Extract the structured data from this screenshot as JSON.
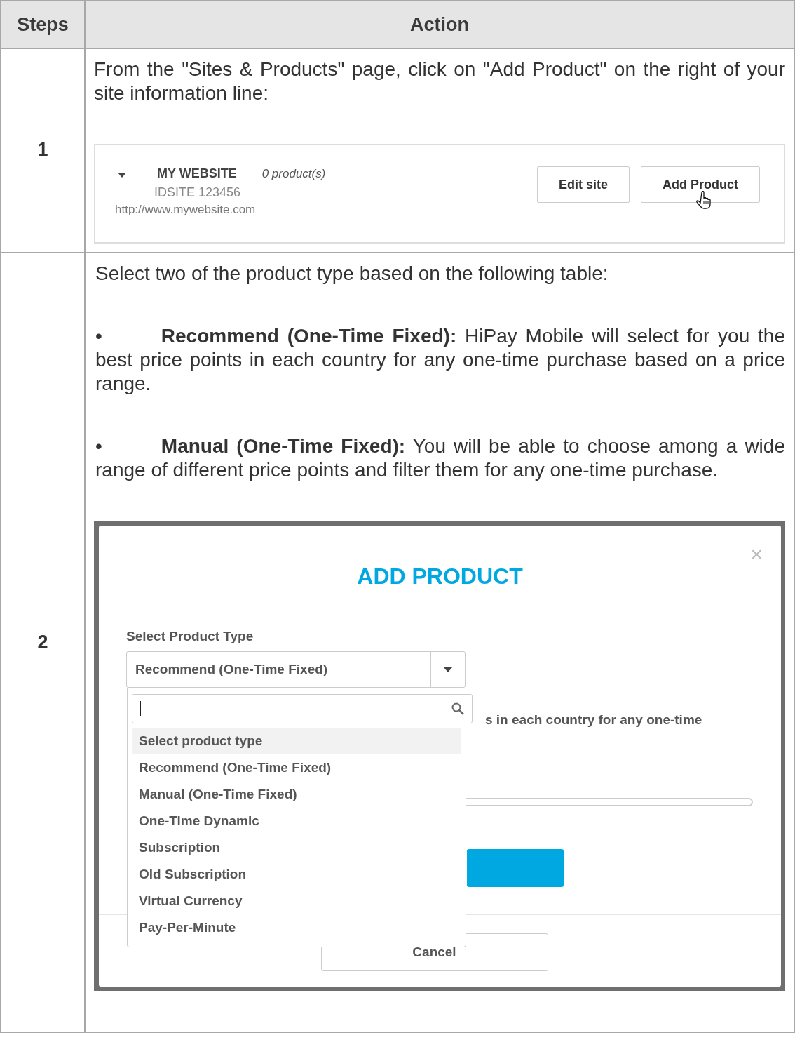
{
  "table": {
    "columns": [
      "Steps",
      "Action"
    ],
    "rows": [
      {
        "step": "1",
        "paragraphs": [
          "From the \"Sites & Products\" page, click on \"Add Product\" on the right of your site information line:"
        ],
        "figure": {
          "kind": "site_line",
          "site_name": "MY WEBSITE",
          "product_count": "0 product(s)",
          "site_id": "IDSITE 123456",
          "url": "http://www.mywebsite.com",
          "buttons": [
            "Edit site",
            "Add Product"
          ]
        }
      },
      {
        "step": "2",
        "paragraphs": [
          "Select two of the product type based on the following table:",
          "•   **Recommend (One-Time Fixed):** HiPay Mobile will select for you the best price points in each country for any one-time purchase based on a price range.",
          "•   **Manual (One-Time Fixed):** You will be able to choose among a wide range of different price points and filter them for any one-time purchase."
        ],
        "figure": {
          "kind": "modal",
          "title": "ADD PRODUCT",
          "close": "×",
          "field_label": "Select Product Type",
          "select_value": "Recommend (One-Time Fixed)",
          "behind_text": "s in each country for any one-time",
          "cancel": "Cancel",
          "options": [
            {
              "label": "Select product type",
              "selected": true
            },
            {
              "label": "Recommend (One-Time Fixed)",
              "selected": false
            },
            {
              "label": "Manual (One-Time Fixed)",
              "selected": false
            },
            {
              "label": "One-Time Dynamic",
              "selected": false
            },
            {
              "label": "Subscription",
              "selected": false
            },
            {
              "label": "Old Subscription",
              "selected": false
            },
            {
              "label": "Virtual Currency",
              "selected": false
            },
            {
              "label": "Pay-Per-Minute",
              "selected": false
            }
          ]
        }
      }
    ]
  }
}
